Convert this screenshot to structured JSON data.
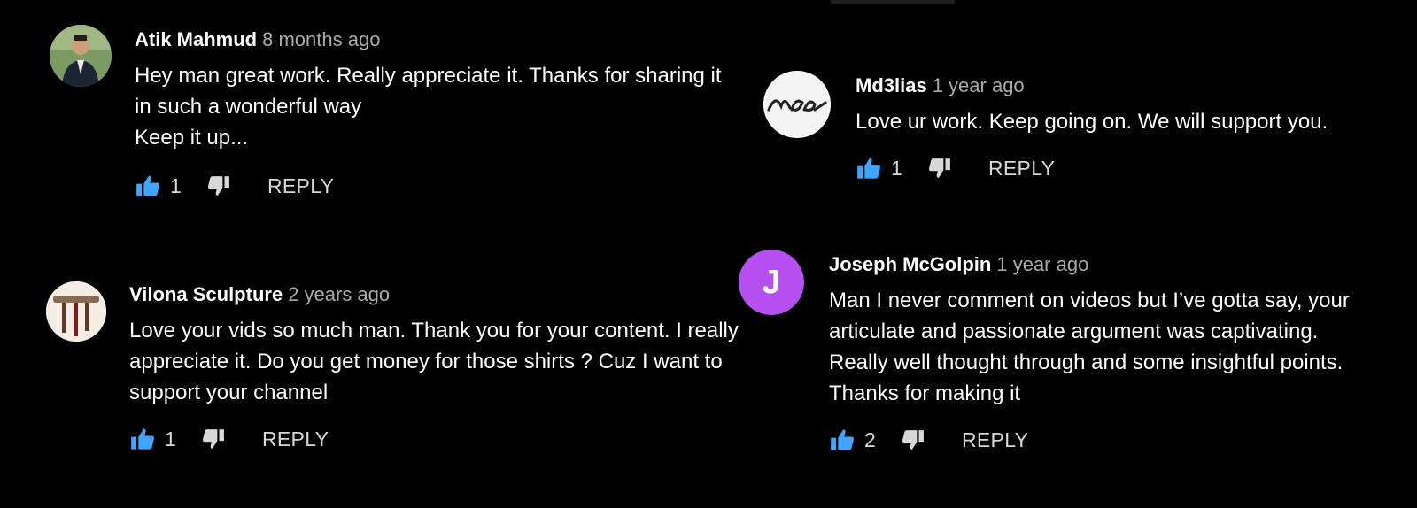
{
  "colors": {
    "background": "#000000",
    "like_accent": "#3ea6ff",
    "secondary_text": "#aaaaaa",
    "letter_avatar_bg": "#b64ff0"
  },
  "icons": {
    "like": "thumb-up-icon",
    "dislike": "thumb-down-icon"
  },
  "comments": [
    {
      "author": "Atik Mahmud",
      "time": "8 months ago",
      "lines": [
        "Hey man great work. Really appreciate it. Thanks for sharing it",
        "in such a wonderful way",
        "Keep it up..."
      ],
      "likes": "1",
      "reply": "REPLY"
    },
    {
      "author": "Md3lias",
      "time": "1 year ago",
      "lines": [
        "Love ur work. Keep going on. We will support you."
      ],
      "likes": "1",
      "reply": "REPLY"
    },
    {
      "author": "Vilona Sculpture",
      "time": "2 years ago",
      "lines": [
        "Love your vids so much man. Thank you for your content. I really",
        "appreciate it. Do you get money for those shirts ? Cuz I want to",
        "support your channel"
      ],
      "likes": "1",
      "reply": "REPLY"
    },
    {
      "author": "Joseph McGolpin",
      "time": "1 year ago",
      "avatar_letter": "J",
      "lines": [
        "Man I never comment on videos but I’ve gotta say, your",
        "articulate and passionate argument was captivating.",
        "Really well thought through and some insightful points.",
        "Thanks for making it"
      ],
      "likes": "2",
      "reply": "REPLY"
    }
  ]
}
